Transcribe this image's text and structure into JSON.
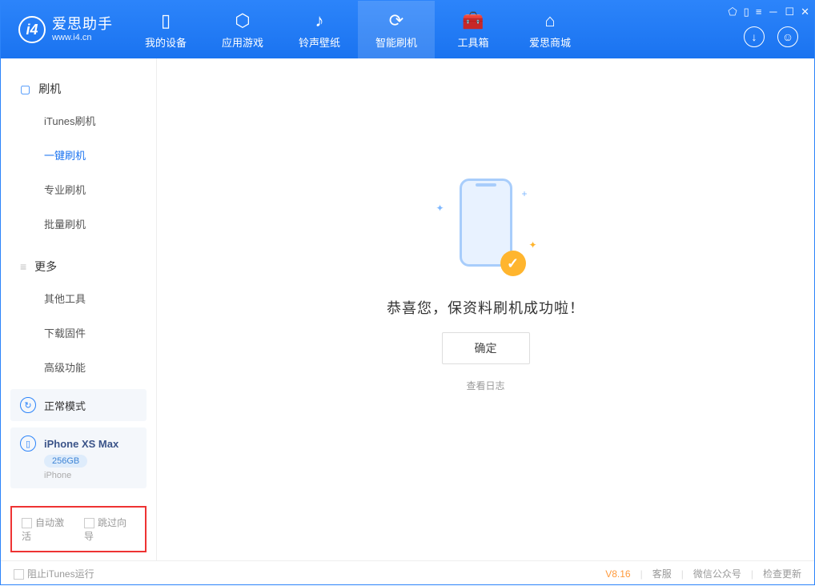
{
  "app": {
    "title": "爱思助手",
    "subtitle": "www.i4.cn"
  },
  "nav": {
    "items": [
      {
        "label": "我的设备"
      },
      {
        "label": "应用游戏"
      },
      {
        "label": "铃声壁纸"
      },
      {
        "label": "智能刷机"
      },
      {
        "label": "工具箱"
      },
      {
        "label": "爱思商城"
      }
    ]
  },
  "sidebar": {
    "group1": {
      "title": "刷机",
      "items": [
        "iTunes刷机",
        "一键刷机",
        "专业刷机",
        "批量刷机"
      ]
    },
    "group2": {
      "title": "更多",
      "items": [
        "其他工具",
        "下载固件",
        "高级功能"
      ]
    },
    "mode_card": "正常模式",
    "device": {
      "name": "iPhone XS Max",
      "storage": "256GB",
      "type": "iPhone"
    },
    "checkboxes": {
      "auto_activate": "自动激活",
      "skip_guide": "跳过向导"
    }
  },
  "main": {
    "success_message": "恭喜您，保资料刷机成功啦！",
    "ok_button": "确定",
    "view_log": "查看日志"
  },
  "footer": {
    "block_itunes": "阻止iTunes运行",
    "version": "V8.16",
    "links": {
      "service": "客服",
      "wechat": "微信公众号",
      "update": "检查更新"
    }
  }
}
